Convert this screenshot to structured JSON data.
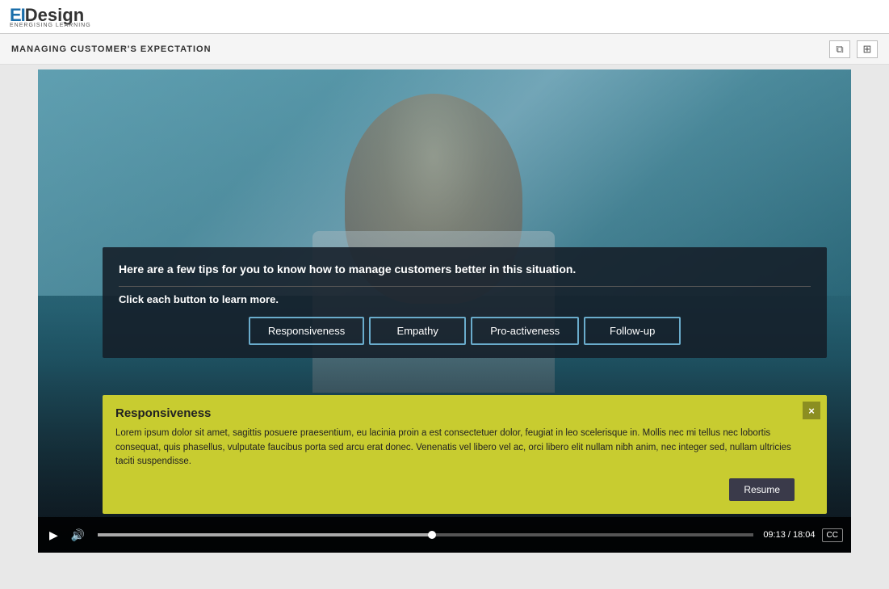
{
  "header": {
    "logo_ei": "EI",
    "logo_design": "Design",
    "logo_subtitle": "ENERGISING LEARNING"
  },
  "topbar": {
    "title": "MANAGING CUSTOMER'S EXPECTATION",
    "icon_external": "⧉",
    "icon_grid": "⊞"
  },
  "video": {
    "overlay": {
      "tip_text": "Here are a few tips for you to know how to manage customers better in this situation.",
      "instruction": "Click each button to learn more.",
      "buttons": [
        {
          "label": "Responsiveness",
          "id": "btn-responsiveness"
        },
        {
          "label": "Empathy",
          "id": "btn-empathy"
        },
        {
          "label": "Pro-activeness",
          "id": "btn-proactiveness"
        },
        {
          "label": "Follow-up",
          "id": "btn-followup"
        }
      ]
    },
    "popup": {
      "title": "Responsiveness",
      "body": "Lorem ipsum dolor sit amet, sagittis posuere praesentium, eu lacinia proin a est consectetuer dolor, feugiat in leo scelerisque in. Mollis nec mi tellus nec lobortis consequat, quis phasellus, vulputate faucibus porta sed arcu erat donec. Venenatis vel libero vel ac, orci libero elit nullam nibh anim, nec integer sed, nullam ultricies taciti suspendisse.",
      "resume_label": "Resume",
      "close_label": "×"
    },
    "controls": {
      "play_icon": "▶",
      "volume_icon": "🔊",
      "time_current": "09:13",
      "time_total": "18:04",
      "time_display": "09:13 / 18:04",
      "progress_percent": 51,
      "cc_label": "CC"
    }
  }
}
